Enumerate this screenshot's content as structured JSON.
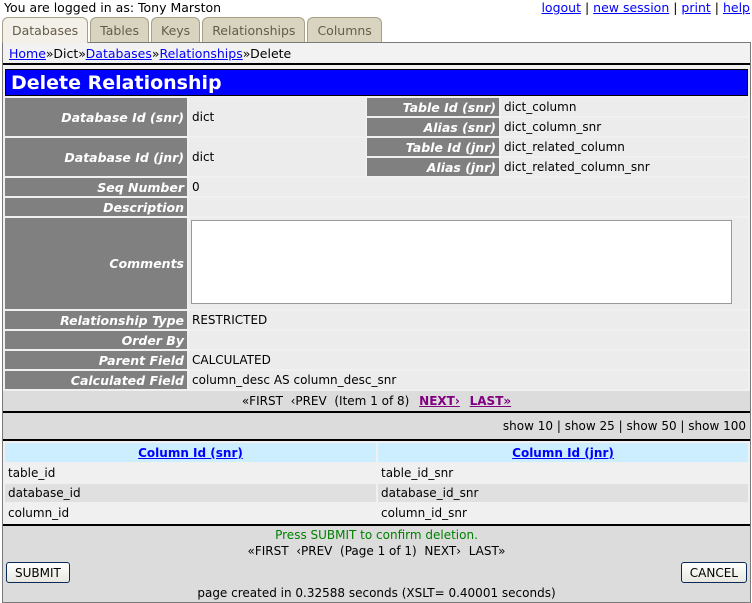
{
  "header": {
    "logged_in": "You are logged in as: Tony Marston",
    "links": [
      "logout",
      "new session",
      "print",
      "help"
    ]
  },
  "tabs": [
    "Databases",
    "Tables",
    "Keys",
    "Relationships",
    "Columns"
  ],
  "breadcrumb": {
    "home": "Home",
    "dict": "Dict",
    "databases": "Databases",
    "relationships": "Relationships",
    "current": "Delete"
  },
  "title": "Delete Relationship",
  "form": {
    "db_snr_label": "Database Id (snr)",
    "db_snr": "dict",
    "table_snr_label": "Table Id (snr)",
    "table_snr": "dict_column",
    "alias_snr_label": "Alias (snr)",
    "alias_snr": "dict_column_snr",
    "db_jnr_label": "Database Id (jnr)",
    "db_jnr": "dict",
    "table_jnr_label": "Table Id (jnr)",
    "table_jnr": "dict_related_column",
    "alias_jnr_label": "Alias (jnr)",
    "alias_jnr": "dict_related_column_snr",
    "seq_label": "Seq Number",
    "seq": "0",
    "desc_label": "Description",
    "desc": "",
    "comments_label": "Comments",
    "comments": "",
    "reltype_label": "Relationship Type",
    "reltype": "RESTRICTED",
    "orderby_label": "Order By",
    "orderby": "",
    "parent_label": "Parent Field",
    "parent": "CALCULATED",
    "calc_label": "Calculated Field",
    "calc": "column_desc AS column_desc_snr"
  },
  "item_nav": {
    "first": "«FIRST",
    "prev": "‹PREV",
    "info": "(Item 1 of 8)",
    "next": "NEXT›",
    "last": "LAST»"
  },
  "show": [
    "show 10",
    "show 25",
    "show 50",
    "show 100"
  ],
  "list": {
    "headers": [
      "Column Id (snr)",
      "Column Id (jnr)"
    ],
    "rows": [
      [
        "table_id",
        "table_id_snr"
      ],
      [
        "database_id",
        "database_id_snr"
      ],
      [
        "column_id",
        "column_id_snr"
      ]
    ]
  },
  "message": "Press SUBMIT to confirm deletion.",
  "page_nav": {
    "first": "«FIRST",
    "prev": "‹PREV",
    "info": "(Page 1 of 1)",
    "next": "NEXT›",
    "last": "LAST»"
  },
  "buttons": {
    "submit": "SUBMIT",
    "cancel": "CANCEL"
  },
  "footer": "page created in 0.32588 seconds (XSLT= 0.40001 seconds)"
}
